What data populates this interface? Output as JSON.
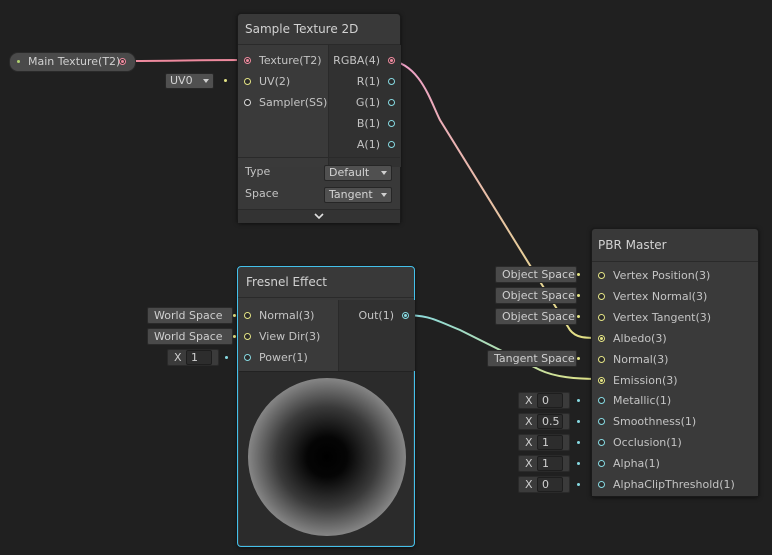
{
  "property_node": {
    "label": "Main Texture(T2)"
  },
  "uv_dropdown": {
    "value": "UV0"
  },
  "sample_texture": {
    "title": "Sample Texture 2D",
    "inputs": [
      {
        "label": "Texture(T2)",
        "color": "#ee8a9e"
      },
      {
        "label": "UV(2)",
        "color": "#e3e384"
      },
      {
        "label": "Sampler(SS)",
        "color": "#d8d8d8"
      }
    ],
    "outputs": [
      {
        "label": "RGBA(4)",
        "color": "#ee8a9e"
      },
      {
        "label": "R(1)",
        "color": "#86d9e1"
      },
      {
        "label": "G(1)",
        "color": "#86d9e1"
      },
      {
        "label": "B(1)",
        "color": "#86d9e1"
      },
      {
        "label": "A(1)",
        "color": "#86d9e1"
      }
    ],
    "settings": [
      {
        "label": "Type",
        "value": "Default"
      },
      {
        "label": "Space",
        "value": "Tangent"
      }
    ],
    "collapse_icon": "chevron-down-icon"
  },
  "fresnel": {
    "title": "Fresnel Effect",
    "inputs": [
      {
        "label": "Normal(3)",
        "color": "#e3e384",
        "default": "World Space"
      },
      {
        "label": "View Dir(3)",
        "color": "#e3e384",
        "default": "World Space"
      },
      {
        "label": "Power(1)",
        "color": "#86d9e1",
        "default_axis": "X",
        "default_value": "1"
      }
    ],
    "output": {
      "label": "Out(1)",
      "color": "#86d9e1"
    }
  },
  "pbr_master": {
    "title": "PBR Master",
    "inputs": [
      {
        "label": "Vertex Position(3)",
        "color": "#e3e384",
        "default": "Object Space"
      },
      {
        "label": "Vertex Normal(3)",
        "color": "#e3e384",
        "default": "Object Space"
      },
      {
        "label": "Vertex Tangent(3)",
        "color": "#e3e384",
        "default": "Object Space"
      },
      {
        "label": "Albedo(3)",
        "color": "#e3e384"
      },
      {
        "label": "Normal(3)",
        "color": "#e3e384",
        "default": "Tangent Space"
      },
      {
        "label": "Emission(3)",
        "color": "#e3e384"
      },
      {
        "label": "Metallic(1)",
        "color": "#86d9e1",
        "default_axis": "X",
        "default_value": "0"
      },
      {
        "label": "Smoothness(1)",
        "color": "#86d9e1",
        "default_axis": "X",
        "default_value": "0.5"
      },
      {
        "label": "Occlusion(1)",
        "color": "#86d9e1",
        "default_axis": "X",
        "default_value": "1"
      },
      {
        "label": "Alpha(1)",
        "color": "#86d9e1",
        "default_axis": "X",
        "default_value": "1"
      },
      {
        "label": "AlphaClipThreshold(1)",
        "color": "#86d9e1",
        "default_axis": "X",
        "default_value": "0"
      }
    ]
  },
  "colors": {
    "background": "#202020",
    "node_body": "#393939",
    "selection": "#44c0ea",
    "texture_wire": "#ee8a9e",
    "vector3_wire": "#e3e384",
    "vector1_wire": "#86d9e1"
  }
}
